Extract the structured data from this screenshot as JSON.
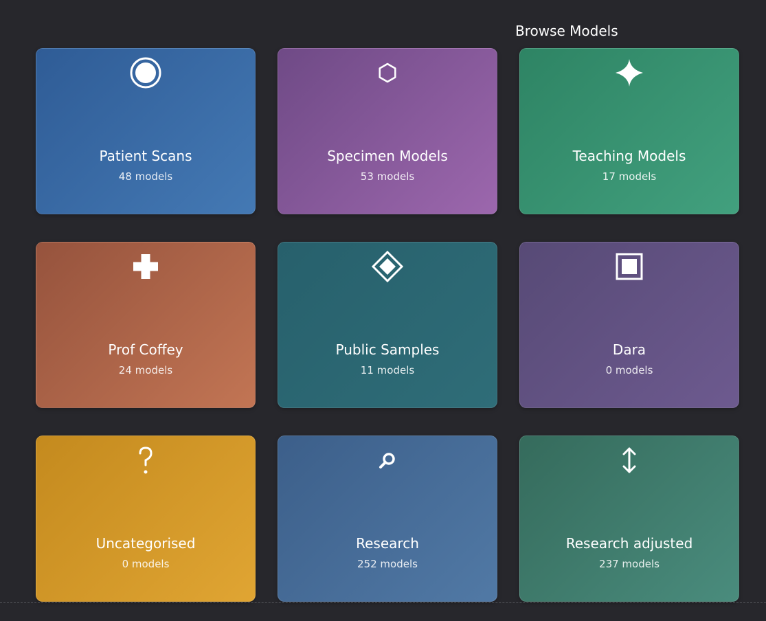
{
  "page": {
    "title": "Browse Models"
  },
  "categories": [
    {
      "name": "Patient Scans",
      "count": "48 models",
      "icon": "circle-icon",
      "color_from": "#2f5c96",
      "color_to": "#4479b4"
    },
    {
      "name": "Specimen Models",
      "count": "53 models",
      "icon": "hexagon-icon",
      "color_from": "#6f4a86",
      "color_to": "#9c67ad"
    },
    {
      "name": "Teaching Models",
      "count": "17 models",
      "icon": "sparkle-icon",
      "color_from": "#2e8464",
      "color_to": "#42a07e"
    },
    {
      "name": "Prof Coffey",
      "count": "24 models",
      "icon": "plus-icon",
      "color_from": "#96533d",
      "color_to": "#c27554"
    },
    {
      "name": "Public Samples",
      "count": "11 models",
      "icon": "diamond-icon",
      "color_from": "#27606c",
      "color_to": "#2f6d78"
    },
    {
      "name": "Dara",
      "count": "0 models",
      "icon": "square-icon",
      "color_from": "#574a76",
      "color_to": "#6d5a8f"
    },
    {
      "name": "Uncategorised",
      "count": "0 models",
      "icon": "question-icon",
      "color_from": "#c48a1e",
      "color_to": "#e0a533"
    },
    {
      "name": "Research",
      "count": "252 models",
      "icon": "search-icon",
      "color_from": "#3c5f8a",
      "color_to": "#5179a5"
    },
    {
      "name": "Research adjusted",
      "count": "237 models",
      "icon": "vertical-arrows-icon",
      "color_from": "#356b5c",
      "color_to": "#4a8c7d"
    }
  ]
}
